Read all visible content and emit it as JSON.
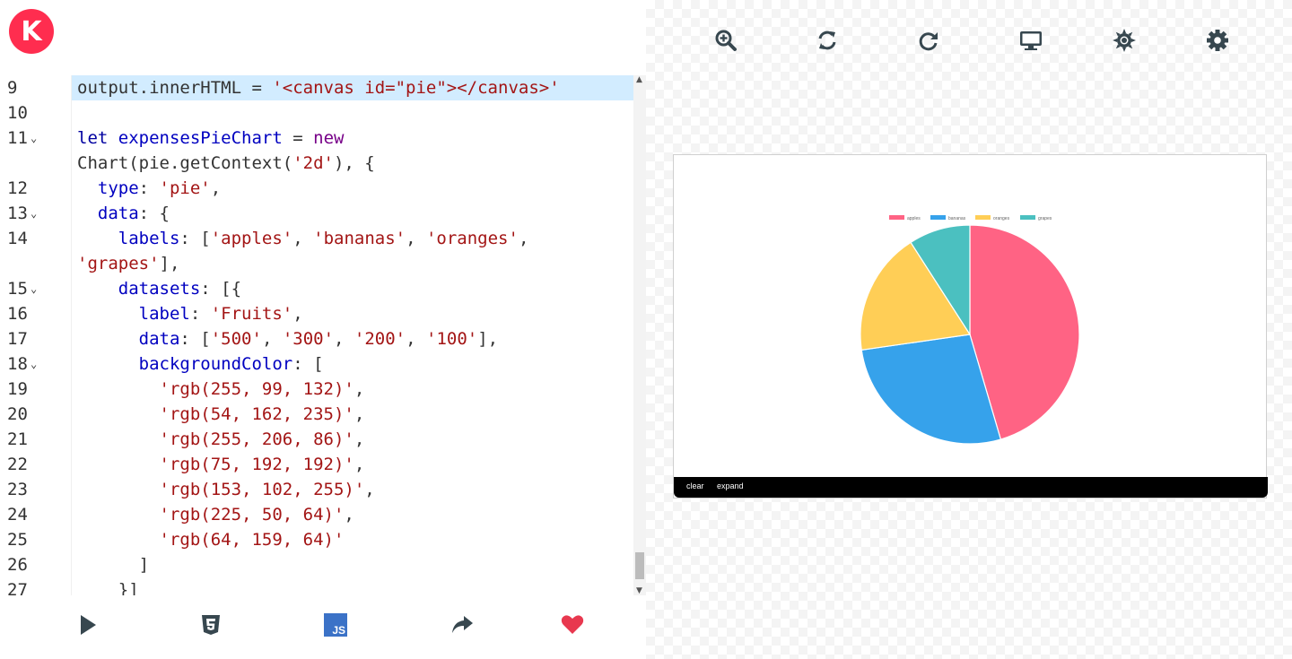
{
  "logo": {
    "letter": "K",
    "color": "#ff2d4f"
  },
  "editor": {
    "active_line": 9,
    "lines": [
      {
        "n": "9",
        "fold": false,
        "tokens": [
          [
            "t",
            "output.innerHTML = "
          ],
          [
            "str",
            "'<canvas id=\"pie\"></canvas>'"
          ]
        ]
      },
      {
        "n": "10",
        "fold": false,
        "tokens": []
      },
      {
        "n": "11",
        "fold": true,
        "tokens": [
          [
            "kw",
            "let "
          ],
          [
            "var",
            "expensesPieChart"
          ],
          [
            "t",
            " = "
          ],
          [
            "kv",
            "new"
          ]
        ]
      },
      {
        "n": "",
        "fold": false,
        "tokens": [
          [
            "t",
            "Chart(pie.getContext("
          ],
          [
            "str",
            "'2d'"
          ],
          [
            "t",
            "), {"
          ]
        ]
      },
      {
        "n": "12",
        "fold": false,
        "tokens": [
          [
            "t",
            "  "
          ],
          [
            "prop",
            "type"
          ],
          [
            "t",
            ": "
          ],
          [
            "str",
            "'pie'"
          ],
          [
            "t",
            ","
          ]
        ]
      },
      {
        "n": "13",
        "fold": true,
        "tokens": [
          [
            "t",
            "  "
          ],
          [
            "prop",
            "data"
          ],
          [
            "t",
            ": {"
          ]
        ]
      },
      {
        "n": "14",
        "fold": false,
        "tokens": [
          [
            "t",
            "    "
          ],
          [
            "prop",
            "labels"
          ],
          [
            "t",
            ": ["
          ],
          [
            "str",
            "'apples'"
          ],
          [
            "t",
            ", "
          ],
          [
            "str",
            "'bananas'"
          ],
          [
            "t",
            ", "
          ],
          [
            "str",
            "'oranges'"
          ],
          [
            "t",
            ","
          ]
        ]
      },
      {
        "n": "",
        "fold": false,
        "tokens": [
          [
            "str",
            "'grapes'"
          ],
          [
            "t",
            "],"
          ]
        ]
      },
      {
        "n": "15",
        "fold": true,
        "tokens": [
          [
            "t",
            "    "
          ],
          [
            "prop",
            "datasets"
          ],
          [
            "t",
            ": [{"
          ]
        ]
      },
      {
        "n": "16",
        "fold": false,
        "tokens": [
          [
            "t",
            "      "
          ],
          [
            "prop",
            "label"
          ],
          [
            "t",
            ": "
          ],
          [
            "str",
            "'Fruits'"
          ],
          [
            "t",
            ","
          ]
        ]
      },
      {
        "n": "17",
        "fold": false,
        "tokens": [
          [
            "t",
            "      "
          ],
          [
            "prop",
            "data"
          ],
          [
            "t",
            ": ["
          ],
          [
            "str",
            "'500'"
          ],
          [
            "t",
            ", "
          ],
          [
            "str",
            "'300'"
          ],
          [
            "t",
            ", "
          ],
          [
            "str",
            "'200'"
          ],
          [
            "t",
            ", "
          ],
          [
            "str",
            "'100'"
          ],
          [
            "t",
            "],"
          ]
        ]
      },
      {
        "n": "18",
        "fold": true,
        "tokens": [
          [
            "t",
            "      "
          ],
          [
            "prop",
            "backgroundColor"
          ],
          [
            "t",
            ": ["
          ]
        ]
      },
      {
        "n": "19",
        "fold": false,
        "tokens": [
          [
            "t",
            "        "
          ],
          [
            "str",
            "'rgb(255, 99, 132)'"
          ],
          [
            "t",
            ","
          ]
        ]
      },
      {
        "n": "20",
        "fold": false,
        "tokens": [
          [
            "t",
            "        "
          ],
          [
            "str",
            "'rgb(54, 162, 235)'"
          ],
          [
            "t",
            ","
          ]
        ]
      },
      {
        "n": "21",
        "fold": false,
        "tokens": [
          [
            "t",
            "        "
          ],
          [
            "str",
            "'rgb(255, 206, 86)'"
          ],
          [
            "t",
            ","
          ]
        ]
      },
      {
        "n": "22",
        "fold": false,
        "tokens": [
          [
            "t",
            "        "
          ],
          [
            "str",
            "'rgb(75, 192, 192)'"
          ],
          [
            "t",
            ","
          ]
        ]
      },
      {
        "n": "23",
        "fold": false,
        "tokens": [
          [
            "t",
            "        "
          ],
          [
            "str",
            "'rgb(153, 102, 255)'"
          ],
          [
            "t",
            ","
          ]
        ]
      },
      {
        "n": "24",
        "fold": false,
        "tokens": [
          [
            "t",
            "        "
          ],
          [
            "str",
            "'rgb(225, 50, 64)'"
          ],
          [
            "t",
            ","
          ]
        ]
      },
      {
        "n": "25",
        "fold": false,
        "tokens": [
          [
            "t",
            "        "
          ],
          [
            "str",
            "'rgb(64, 159, 64)'"
          ]
        ]
      },
      {
        "n": "26",
        "fold": false,
        "tokens": [
          [
            "t",
            "      ]"
          ]
        ]
      },
      {
        "n": "27",
        "fold": false,
        "tokens": [
          [
            "t",
            "    }]"
          ]
        ]
      }
    ]
  },
  "toolbar_bottom": {
    "icons": [
      "play-icon",
      "html5-icon",
      "js-icon",
      "share-icon",
      "heart-icon"
    ],
    "js_label": "JS",
    "heart_color": "#e8384f",
    "js_color": "#3b72c7",
    "icon_color": "#37474f"
  },
  "toolbar_top": {
    "icons": [
      "zoom-in-icon",
      "sync-icon",
      "redo-icon",
      "desktop-icon",
      "sun-icon",
      "gear-icon"
    ]
  },
  "preview": {
    "console": {
      "clear": "clear",
      "expand": "expand"
    }
  },
  "chart_data": {
    "type": "pie",
    "categories": [
      "apples",
      "bananas",
      "oranges",
      "grapes"
    ],
    "values": [
      500,
      300,
      200,
      100
    ],
    "colors": [
      "#ff6384",
      "#36a2eb",
      "#ffce56",
      "#4bc0c0"
    ],
    "legend": "top"
  }
}
